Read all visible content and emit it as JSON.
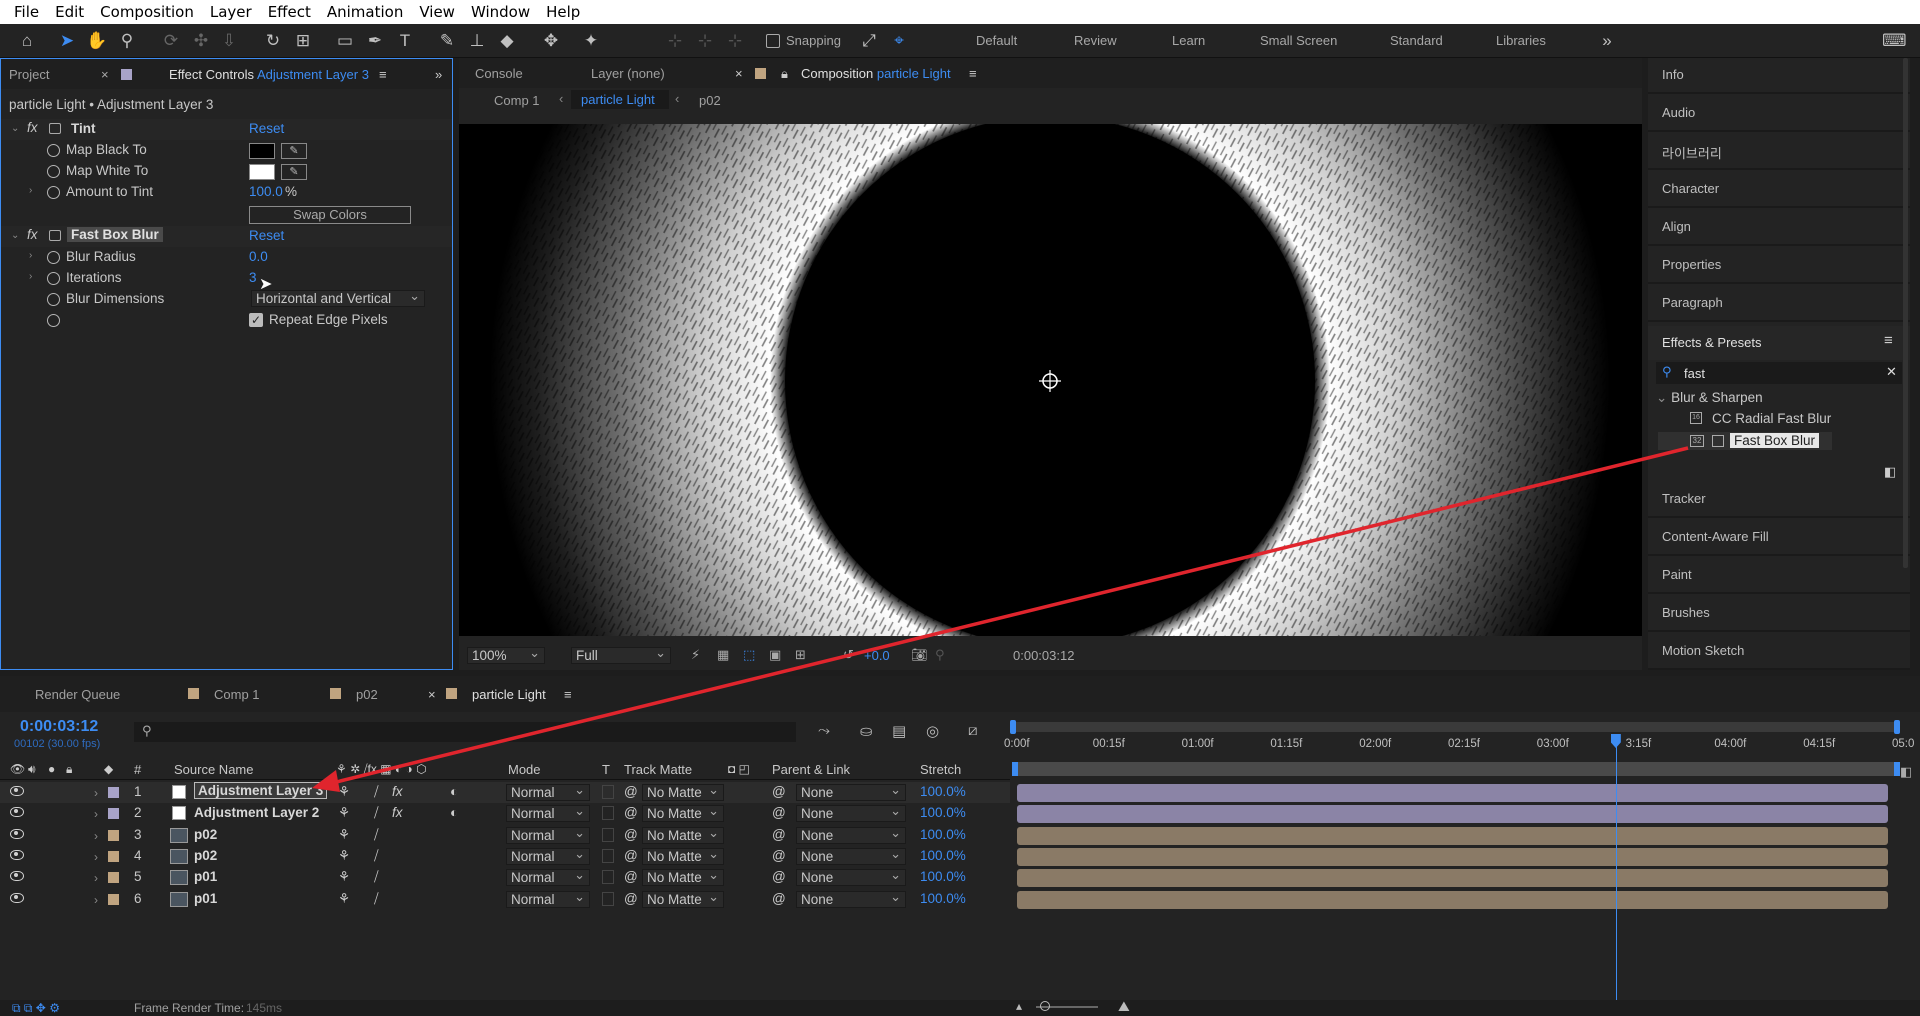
{
  "menu": [
    "File",
    "Edit",
    "Composition",
    "Layer",
    "Effect",
    "Animation",
    "View",
    "Window",
    "Help"
  ],
  "toolbar": {
    "snapping_label": "Snapping",
    "workspaces": [
      "Default",
      "Review",
      "Learn",
      "Small Screen",
      "Standard",
      "Libraries"
    ]
  },
  "left_panel": {
    "tabs": {
      "project": "Project",
      "effect_controls": "Effect Controls",
      "effect_controls_layer": "Adjustment Layer 3"
    },
    "breadcrumb": "particle Light • Adjustment Layer 3",
    "effects": [
      {
        "fx": "fx",
        "name": "Tint",
        "reset": "Reset",
        "props": [
          {
            "label": "Map Black To",
            "color": "#000000"
          },
          {
            "label": "Map White To",
            "color": "#ffffff"
          },
          {
            "label": "Amount to Tint",
            "value": "100.0",
            "unit": "%"
          }
        ],
        "button": "Swap Colors"
      },
      {
        "fx": "fx",
        "name": "Fast Box Blur",
        "reset": "Reset",
        "props": [
          {
            "label": "Blur Radius",
            "value": "0.0"
          },
          {
            "label": "Iterations",
            "value": "3"
          },
          {
            "label": "Blur Dimensions",
            "select": "Horizontal and Vertical"
          },
          {
            "label": "",
            "checkbox": "Repeat Edge Pixels",
            "checked": true
          }
        ]
      }
    ]
  },
  "comp_panel": {
    "tabs": {
      "console": "Console",
      "layer": "Layer (none)",
      "composition": "Composition",
      "composition_name": "particle Light"
    },
    "breadcrumbs": [
      "Comp 1",
      "particle Light",
      "p02"
    ],
    "footer": {
      "zoom": "100%",
      "resolution": "Full",
      "exposure": "+0.0",
      "timecode": "0:00:03:12"
    }
  },
  "right_panel": {
    "items_top": [
      "Info",
      "Audio",
      "라이브러리",
      "Character",
      "Align",
      "Properties",
      "Paragraph"
    ],
    "effects_presets": {
      "title": "Effects & Presets",
      "search_value": "fast",
      "category": "Blur & Sharpen",
      "results": [
        {
          "name": "CC Radial Fast Blur",
          "badge": ""
        },
        {
          "name": "Fast Box Blur",
          "badge": "32"
        }
      ]
    },
    "items_bottom": [
      "Tracker",
      "Content-Aware Fill",
      "Paint",
      "Brushes",
      "Motion Sketch"
    ]
  },
  "timeline": {
    "tabs": [
      "Render Queue",
      "Comp 1",
      "p02",
      "particle Light"
    ],
    "timecode": "0:00:03:12",
    "frame_info": "00102 (30.00 fps)",
    "columns": {
      "num": "#",
      "source": "Source Name",
      "mode": "Mode",
      "t": "T",
      "track_matte": "Track Matte",
      "parent": "Parent & Link",
      "stretch": "Stretch"
    },
    "ruler": [
      "0:00f",
      "00:15f",
      "01:00f",
      "01:15f",
      "02:00f",
      "02:15f",
      "03:00f",
      "3:15f",
      "04:00f",
      "04:15f",
      "05:0"
    ],
    "playhead_fraction": 0.68,
    "layers": [
      {
        "num": "1",
        "name": "Adjustment Layer 3",
        "color": "#a8a3c8",
        "kind": "adjust",
        "mode": "Normal",
        "matte": "No Matte",
        "parent": "None",
        "stretch": "100.0%",
        "fx": "fx",
        "bar": "#8b84a6"
      },
      {
        "num": "2",
        "name": "Adjustment Layer 2",
        "color": "#a8a3c8",
        "kind": "adjust",
        "mode": "Normal",
        "matte": "No Matte",
        "parent": "None",
        "stretch": "100.0%",
        "fx": "fx",
        "bar": "#8b84a6"
      },
      {
        "num": "3",
        "name": "p02",
        "color": "#c0a480",
        "kind": "footage",
        "mode": "Normal",
        "matte": "No Matte",
        "parent": "None",
        "stretch": "100.0%",
        "fx": "",
        "bar": "#8a7a66"
      },
      {
        "num": "4",
        "name": "p02",
        "color": "#c0a480",
        "kind": "footage",
        "mode": "Normal",
        "matte": "No Matte",
        "parent": "None",
        "stretch": "100.0%",
        "fx": "",
        "bar": "#8a7a66"
      },
      {
        "num": "5",
        "name": "p01",
        "color": "#c0a480",
        "kind": "footage",
        "mode": "Normal",
        "matte": "No Matte",
        "parent": "None",
        "stretch": "100.0%",
        "fx": "",
        "bar": "#8a7a66"
      },
      {
        "num": "6",
        "name": "p01",
        "color": "#c0a480",
        "kind": "footage",
        "mode": "Normal",
        "matte": "No Matte",
        "parent": "None",
        "stretch": "100.0%",
        "fx": "",
        "bar": "#8a7a66"
      }
    ]
  },
  "status": {
    "frame_render_label": "Frame Render Time:",
    "frame_render_value": "145ms"
  },
  "colors": {
    "accent": "#3d8cf2",
    "annotation_arrow": "#e0252d"
  }
}
